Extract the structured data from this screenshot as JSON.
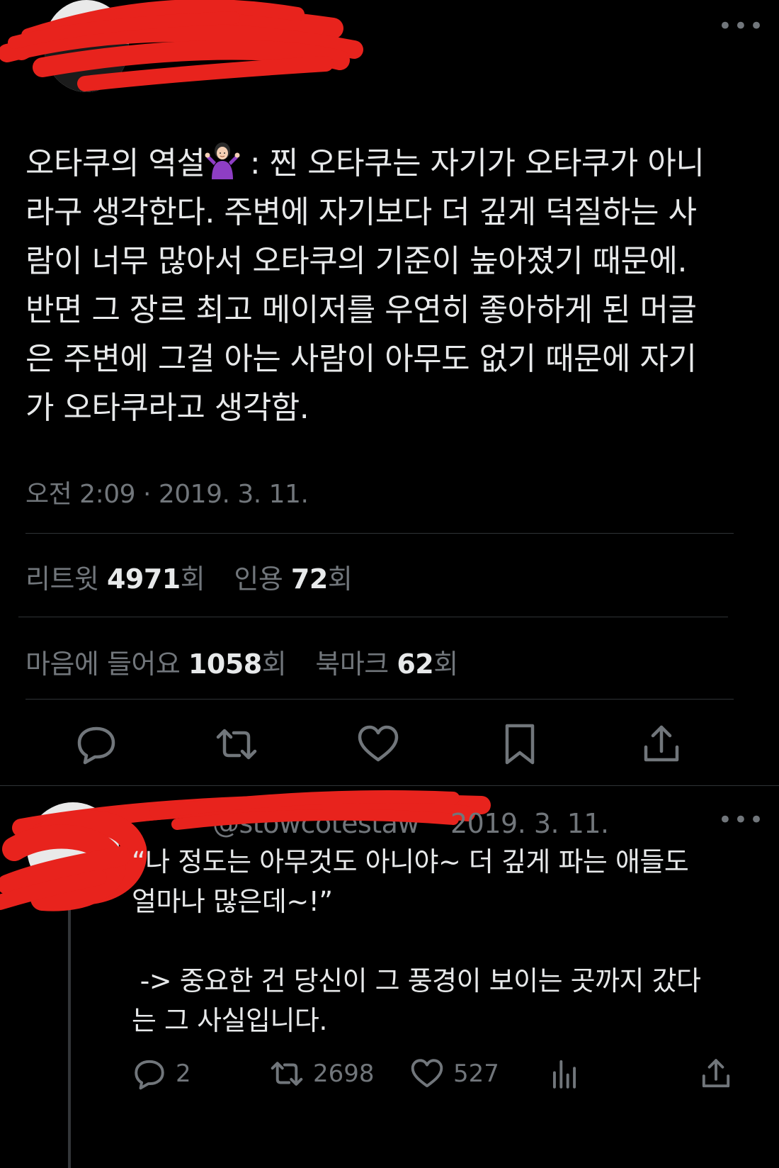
{
  "header": {
    "more_label": "•••"
  },
  "tweet": {
    "text": "오타쿠의 역설",
    "text_rest": " : 찐 오타쿠는 자기가 오타쿠가 아니\n라구 생각한다. 주변에 자기보다 더 깊게 덕질하는 사\n람이 너무 많아서 오타쿠의 기준이 높아졌기 때문에.\n반면 그 장르 최고 메이저를 우연히 좋아하게 된 머글\n은 주변에 그걸 아는 사람이 아무도 없기 때문에 자기\n가 오타쿠라고 생각함.",
    "emoji_icon": "person-shrugging-emoji",
    "timestamp": "오전 2:09 · 2019. 3. 11."
  },
  "stats": {
    "retweets_label": "리트윗",
    "retweets_count": "4971",
    "retweets_unit": "회",
    "quotes_label": "인용",
    "quotes_count": "72",
    "quotes_unit": "회",
    "likes_label": "마음에 들어요",
    "likes_count": "1058",
    "likes_unit": "회",
    "bookmarks_label": "북마크",
    "bookmarks_count": "62",
    "bookmarks_unit": "회"
  },
  "actions": [
    "reply-icon",
    "retweet-icon",
    "like-icon",
    "bookmark-icon",
    "share-icon"
  ],
  "reply": {
    "handle": "@stowcotestaw",
    "date": "2019. 3. 11.",
    "more_label": "•••",
    "text": "“나 정도는 아무것도 아니야~ 더 깊게 파는 애들도\n얼마나 많은데~!”\n\n -> 중요한 건 당신이 그 풍경이 보이는 곳까지 갔다\n는 그 사실입니다.",
    "reply_count": "2",
    "retweet_count": "2698",
    "like_count": "527"
  },
  "colors": {
    "background": "#000000",
    "text": "#e7e9ea",
    "muted": "#71767b",
    "divider": "#2f3336",
    "redaction": "#e8231d"
  }
}
